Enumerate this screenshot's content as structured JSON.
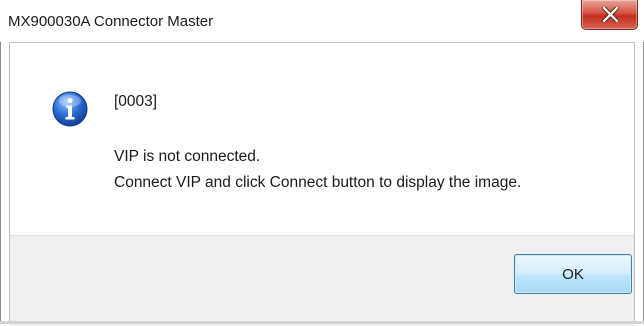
{
  "window": {
    "title": "MX900030A Connector Master",
    "close_icon": "close-icon"
  },
  "message": {
    "icon": "info-icon",
    "code": "[0003]",
    "line1": "VIP is not connected.",
    "line2": "Connect VIP and click Connect button to display the image."
  },
  "buttons": {
    "ok_label": "OK"
  },
  "colors": {
    "close_button": "#c8402b",
    "info_icon": "#1f5fbf",
    "ok_button_border": "#3c7fb1",
    "button_pane": "#f0f0f0"
  }
}
